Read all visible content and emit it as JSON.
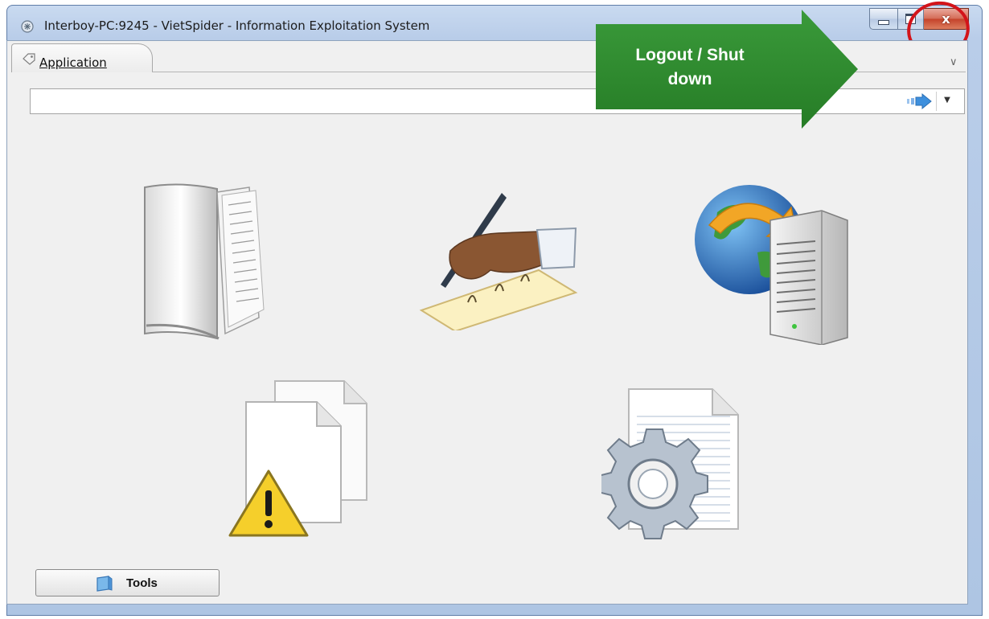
{
  "window": {
    "title": "Interboy-PC:9245 - VietSpider - Information Exploitation System",
    "close_glyph": "x",
    "icons": [
      "app-icon",
      "minimize-icon",
      "maximize-icon",
      "close-icon"
    ]
  },
  "tabs": [
    {
      "label": "Application",
      "icon": "tag-icon"
    }
  ],
  "address_bar": {
    "value": "",
    "go_icon": "go-arrow-icon",
    "dropdown_icon": "chevron-down-icon"
  },
  "annotation": {
    "text": "Logout / Shut down",
    "line1": "Logout / Shut",
    "line2": "down",
    "arrow_color": "#2e8b2e",
    "circle_color": "#d3141a"
  },
  "launch_icons": [
    "book-icon",
    "signing-hand-icon",
    "globe-server-icon",
    "documents-warning-icon",
    "document-gear-icon"
  ],
  "footer": {
    "tools_label": "Tools",
    "tools_icon": "tools-icon"
  }
}
